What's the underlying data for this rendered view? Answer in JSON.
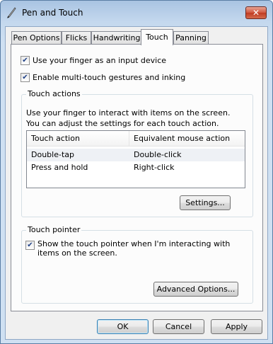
{
  "window": {
    "title": "Pen and Touch",
    "close_label": "✕"
  },
  "tabs": [
    {
      "label": "Pen Options"
    },
    {
      "label": "Flicks"
    },
    {
      "label": "Handwriting"
    },
    {
      "label": "Touch"
    },
    {
      "label": "Panning"
    }
  ],
  "options": {
    "use_finger": {
      "label": "Use your finger as an input device",
      "checked": "✔"
    },
    "multitouch": {
      "label": "Enable multi-touch gestures and inking",
      "checked": "✔"
    }
  },
  "touch_actions": {
    "group_label": "Touch actions",
    "description": "Use your finger to interact with items on the screen. You can adjust the settings for each touch action.",
    "columns": [
      "Touch action",
      "Equivalent mouse action"
    ],
    "rows": [
      {
        "action": "Double-tap",
        "mouse": "Double-click"
      },
      {
        "action": "Press and hold",
        "mouse": "Right-click"
      }
    ],
    "settings_button": "Settings..."
  },
  "touch_pointer": {
    "group_label": "Touch pointer",
    "option_label": "Show the touch pointer when I'm interacting with items on the screen.",
    "checked": "✔",
    "advanced_button": "Advanced Options..."
  },
  "footer": {
    "ok": "OK",
    "cancel": "Cancel",
    "apply": "Apply"
  },
  "colors": {
    "title_gradient": "#a9c4e2",
    "panel": "#fcfcfc",
    "selected_row": "#eef1f5"
  }
}
